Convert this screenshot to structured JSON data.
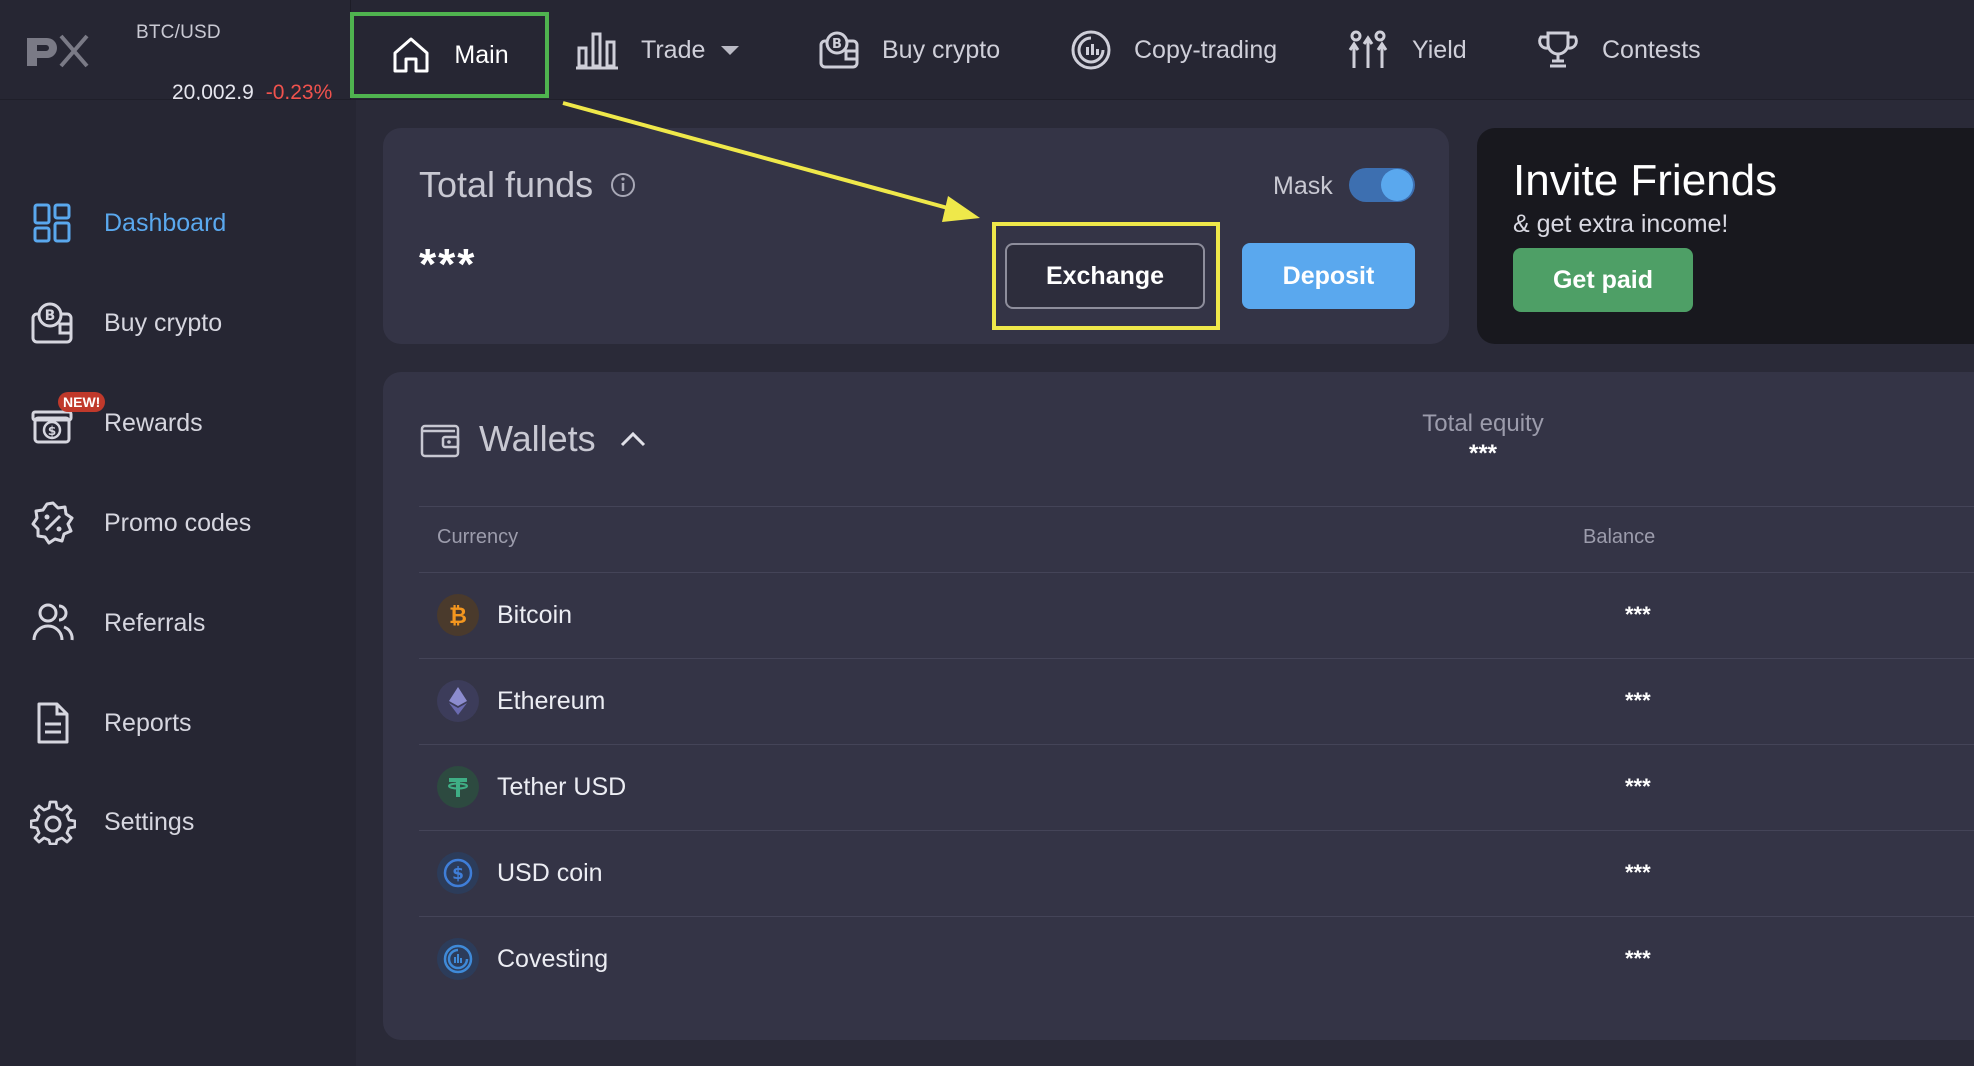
{
  "ticker": {
    "pair": "BTC/USD",
    "price": "20,002.9",
    "change": "-0.23%"
  },
  "nav": [
    {
      "label": "Main",
      "icon": "home-icon"
    },
    {
      "label": "Trade",
      "icon": "bar-chart-icon"
    },
    {
      "label": "Buy crypto",
      "icon": "wallet-bitcoin-icon"
    },
    {
      "label": "Copy-trading",
      "icon": "covesting-icon"
    },
    {
      "label": "Yield",
      "icon": "yield-icon"
    },
    {
      "label": "Contests",
      "icon": "trophy-icon"
    }
  ],
  "sidebar": {
    "new_badge": "NEW!",
    "items": [
      {
        "label": "Dashboard",
        "icon": "dashboard-icon"
      },
      {
        "label": "Buy crypto",
        "icon": "wallet-bitcoin-icon"
      },
      {
        "label": "Rewards",
        "icon": "gift-icon"
      },
      {
        "label": "Promo codes",
        "icon": "percent-badge-icon"
      },
      {
        "label": "Referrals",
        "icon": "users-icon"
      },
      {
        "label": "Reports",
        "icon": "document-icon"
      },
      {
        "label": "Settings",
        "icon": "gear-icon"
      }
    ]
  },
  "funds": {
    "title": "Total funds",
    "value": "***",
    "mask_label": "Mask",
    "mask_on": true,
    "exchange_label": "Exchange",
    "deposit_label": "Deposit"
  },
  "invite": {
    "title": "Invite Friends",
    "subtitle": "& get extra income!",
    "button_label": "Get paid"
  },
  "wallets": {
    "title": "Wallets",
    "equity_label": "Total equity",
    "equity_value": "***",
    "col_currency": "Currency",
    "col_balance": "Balance",
    "rows": [
      {
        "name": "Bitcoin",
        "balance": "***",
        "icon": "bitcoin-icon"
      },
      {
        "name": "Ethereum",
        "balance": "***",
        "icon": "ethereum-icon"
      },
      {
        "name": "Tether USD",
        "balance": "***",
        "icon": "tether-icon"
      },
      {
        "name": "USD coin",
        "balance": "***",
        "icon": "usd-coin-icon"
      },
      {
        "name": "Covesting",
        "balance": "***",
        "icon": "covesting-icon"
      }
    ]
  },
  "colors": {
    "accent_blue": "#5aa8ee",
    "negative_red": "#f0524d",
    "highlight_green": "#4fb34f",
    "highlight_yellow": "#efe84a",
    "get_paid_green": "#4e9f66"
  }
}
